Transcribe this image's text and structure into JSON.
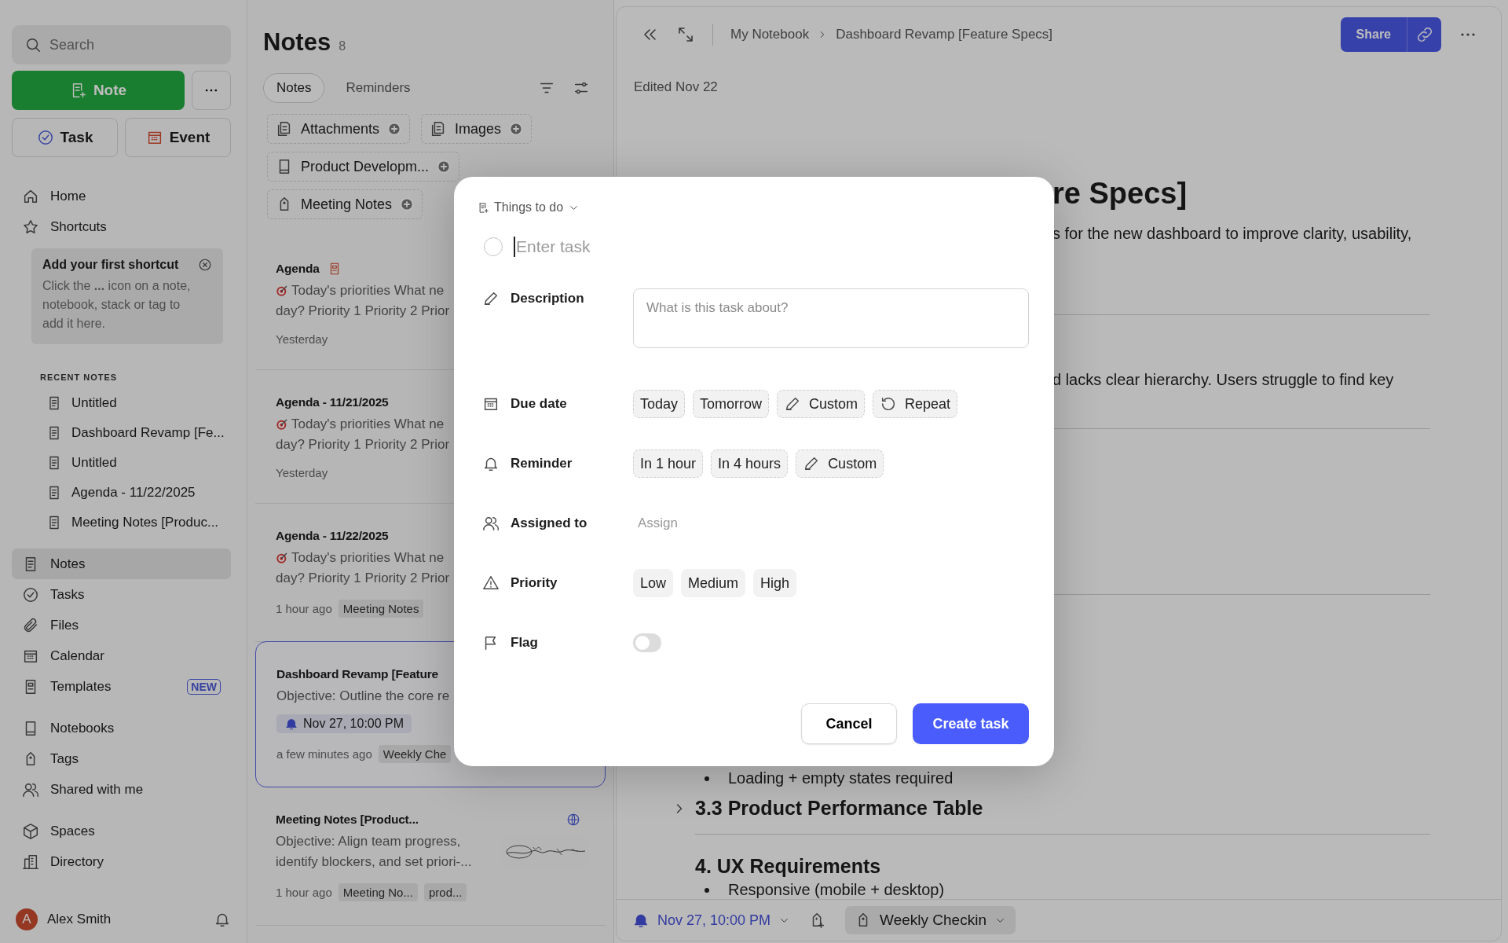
{
  "sidebar": {
    "search": {
      "placeholder": "Search"
    },
    "note_button": "Note",
    "task_button": "Task",
    "event_button": "Event",
    "nav_top": [
      {
        "label": "Home",
        "selected": false
      },
      {
        "label": "Shortcuts",
        "selected": false
      }
    ],
    "shortcut_tip": {
      "title": "Add your first shortcut",
      "text": "Click the **...** icon on a note, notebook, stack or tag to add it here."
    },
    "recent_heading": "RECENT NOTES",
    "recent": [
      "Untitled",
      "Dashboard Revamp [Fe...",
      "Untitled",
      "Agenda - 11/22/2025",
      "Meeting Notes [Produc..."
    ],
    "nav_main": [
      {
        "label": "Notes",
        "selected": true
      },
      {
        "label": "Tasks",
        "selected": false
      },
      {
        "label": "Files",
        "selected": false
      },
      {
        "label": "Calendar",
        "selected": false
      },
      {
        "label": "Templates",
        "selected": false,
        "badge": "NEW"
      }
    ],
    "nav_library": [
      {
        "label": "Notebooks",
        "selected": false
      },
      {
        "label": "Tags",
        "selected": false
      },
      {
        "label": "Shared with me",
        "selected": false
      }
    ],
    "nav_org": [
      {
        "label": "Spaces",
        "selected": false
      },
      {
        "label": "Directory",
        "selected": false
      }
    ],
    "user": {
      "initial": "A",
      "name": "Alex Smith"
    }
  },
  "notes_panel": {
    "title": "Notes",
    "count": "8",
    "tabs": [
      {
        "label": "Notes",
        "selected": true
      },
      {
        "label": "Reminders",
        "selected": false
      }
    ],
    "filters": [
      {
        "label": "Attachments",
        "kind": "files"
      },
      {
        "label": "Images",
        "kind": "files"
      },
      {
        "label": "Product Developm...",
        "kind": "notebook"
      },
      {
        "label": "Meeting Notes",
        "kind": "tag"
      }
    ],
    "notes": [
      {
        "title": "Agenda",
        "template": true,
        "shared": false,
        "target": true,
        "lines": [
          "Today's priorities What ne",
          "day? Priority 1 Priority 2 Prior"
        ],
        "time": "Yesterday",
        "selected": false
      },
      {
        "title": "Agenda - 11/21/2025",
        "template": false,
        "shared": false,
        "target": true,
        "lines": [
          "Today's priorities What ne",
          "day? Priority 1 Priority 2 Prior"
        ],
        "time": "Yesterday",
        "selected": false
      },
      {
        "title": "Agenda - 11/22/2025",
        "template": false,
        "shared": false,
        "target": true,
        "lines": [
          "Today's priorities What ne",
          "day? Priority 1 Priority 2 Prior"
        ],
        "time": "1 hour ago",
        "tags": [
          "Meeting Notes"
        ],
        "selected": false
      },
      {
        "title": "Dashboard Revamp [Feature",
        "template": false,
        "shared": false,
        "target": false,
        "lines": [
          "Objective: Outline the core re"
        ],
        "reminder": "Nov 27, 10:00 PM",
        "time": "a few minutes ago",
        "tags": [
          "Weekly Che"
        ],
        "selected": true
      },
      {
        "title": "Meeting Notes [Product...",
        "template": false,
        "shared": true,
        "target": false,
        "lines": [
          "Objective: Align team progress,",
          "identify blockers, and set priori-..."
        ],
        "thumbnail": {
          "kind": "picture"
        },
        "time": "1 hour ago",
        "tags": [
          "Meeting No...",
          "prod..."
        ],
        "selected": false
      }
    ]
  },
  "editor": {
    "breadcrumb": [
      "My Notebook",
      "Dashboard Revamp [Feature Specs]"
    ],
    "share": "Share",
    "edited": "Edited Nov 22",
    "blocks": [
      {
        "kind": "title",
        "text": "re Specs]"
      },
      {
        "kind": "para",
        "text": "s for the new dashboard to improve clarity, usability,"
      },
      {
        "kind": "rule"
      },
      {
        "kind": "para",
        "text": "d lacks clear hierarchy. Users struggle to find key"
      },
      {
        "kind": "rule"
      },
      {
        "kind": "rule"
      },
      {
        "kind": "bullet",
        "text": "Loading + empty states required"
      },
      {
        "kind": "heading",
        "text": "3.3 Product Performance Table",
        "expanded": false
      },
      {
        "kind": "rule"
      },
      {
        "kind": "heading",
        "text": "4. UX Requirements"
      },
      {
        "kind": "bullet",
        "text": "Responsive (mobile + desktop)"
      }
    ],
    "footer": {
      "reminder": "Nov 27, 10:00 PM",
      "tag": "Weekly Checkin"
    }
  },
  "modal": {
    "list": "Things to do",
    "task": {
      "placeholder": "Enter task",
      "done": false
    },
    "rows": [
      {
        "kind": "text",
        "label": "Description",
        "placeholder": "What is this task about?"
      },
      {
        "kind": "chips",
        "label": "Due date",
        "options": [
          {
            "label": "Today",
            "kind": "plain"
          },
          {
            "label": "Tomorrow",
            "kind": "plain"
          },
          {
            "label": "Custom",
            "kind": "edit"
          },
          {
            "label": "Repeat",
            "kind": "repeat"
          }
        ]
      },
      {
        "kind": "chips",
        "label": "Reminder",
        "options": [
          {
            "label": "In 1 hour",
            "kind": "plain"
          },
          {
            "label": "In 4 hours",
            "kind": "plain"
          },
          {
            "label": "Custom",
            "kind": "edit"
          }
        ]
      },
      {
        "kind": "assign",
        "label": "Assigned to",
        "placeholder": "Assign"
      },
      {
        "kind": "choice",
        "label": "Priority",
        "options": [
          {
            "label": "Low",
            "selected": false
          },
          {
            "label": "Medium",
            "selected": false
          },
          {
            "label": "High",
            "selected": false
          }
        ]
      },
      {
        "kind": "toggle",
        "label": "Flag",
        "on": false
      }
    ],
    "cancel": "Cancel",
    "create": "Create task"
  }
}
